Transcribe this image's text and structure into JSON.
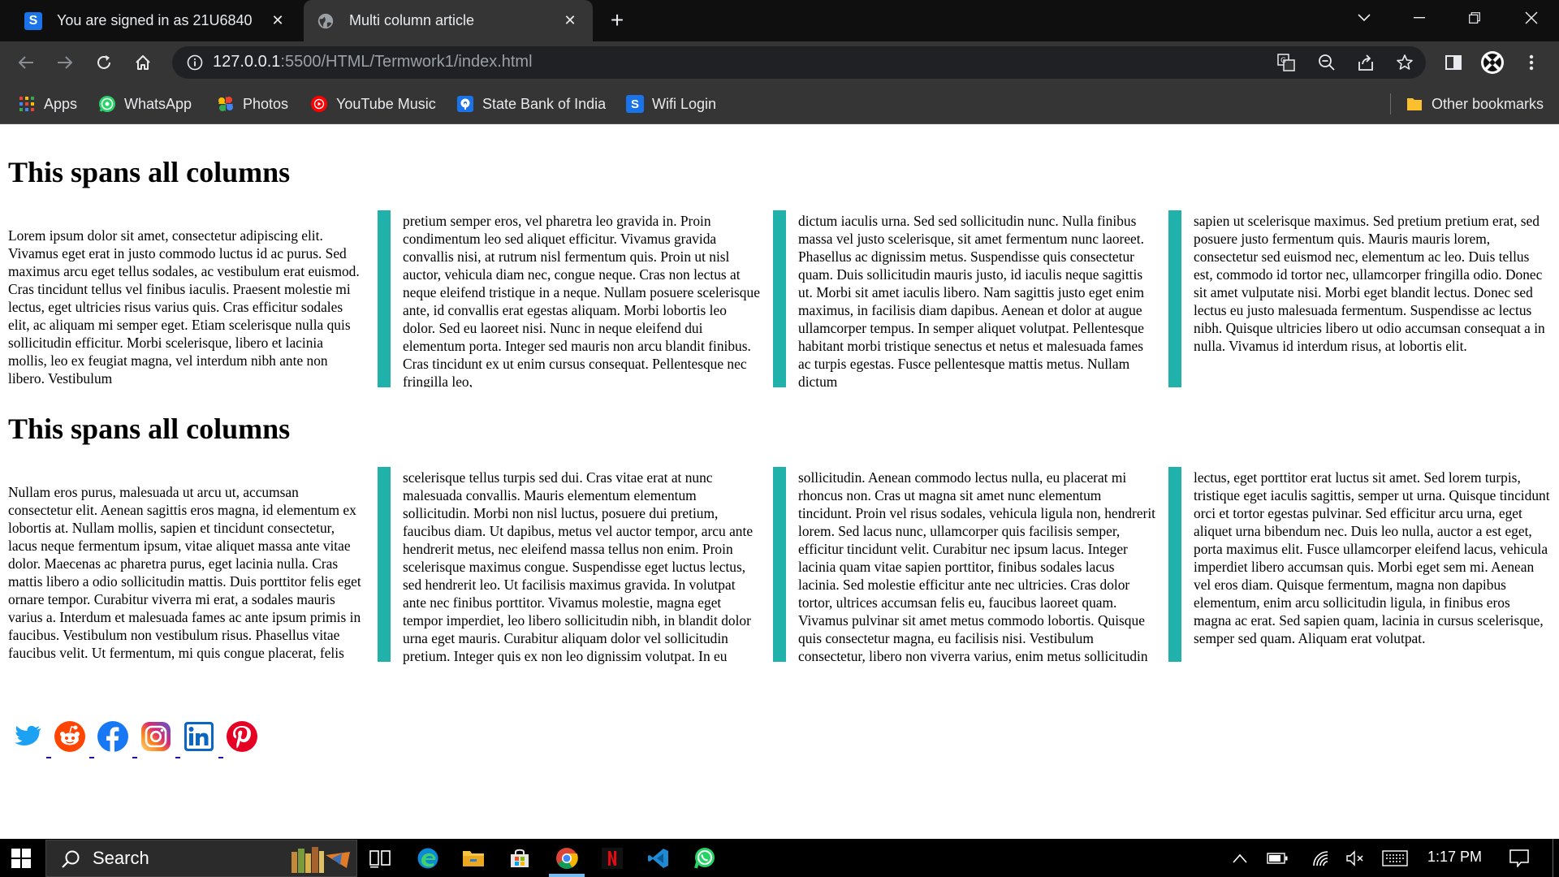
{
  "browser": {
    "tabs": [
      {
        "title": "You are signed in as 21U6840",
        "favicon": "s-logo"
      },
      {
        "title": "Multi column article",
        "favicon": "globe-icon"
      }
    ],
    "url_host": "127.0.0.1",
    "url_rest": ":5500/HTML/Termwork1/index.html"
  },
  "bookmarks": [
    {
      "label": "Apps",
      "icon": "apps-grid-icon"
    },
    {
      "label": "WhatsApp",
      "icon": "whatsapp-icon"
    },
    {
      "label": "Photos",
      "icon": "photos-icon"
    },
    {
      "label": "YouTube Music",
      "icon": "youtube-music-icon"
    },
    {
      "label": "State Bank of India",
      "icon": "sbi-icon"
    },
    {
      "label": "Wifi Login",
      "icon": "s-logo"
    }
  ],
  "other_bookmarks": "Other bookmarks",
  "page": {
    "sections": [
      {
        "heading": "This spans all columns",
        "columns": [
          "Lorem ipsum dolor sit amet, consectetur adipiscing elit. Vivamus eget erat in justo commodo luctus id ac purus. Sed maximus arcu eget tellus sodales, ac vestibulum erat euismod. Cras tincidunt tellus vel finibus iaculis. Praesent molestie mi lectus, eget ultricies risus varius quis. Cras efficitur sodales elit, ac aliquam mi semper eget. Etiam scelerisque nulla quis sollicitudin efficitur. Morbi scelerisque, libero et lacinia mollis, leo ex feugiat magna, vel interdum nibh ante non libero. Vestibulum",
          "pretium semper eros, vel pharetra leo gravida in. Proin condimentum leo sed aliquet efficitur. Vivamus gravida convallis nisi, at rutrum nisl fermentum quis. Proin ut nisl auctor, vehicula diam nec, congue neque. Cras non lectus at neque eleifend tristique in a neque. Nullam posuere scelerisque ante, id convallis erat egestas aliquam. Morbi lobortis leo dolor. Sed eu laoreet nisi. Nunc in neque eleifend dui elementum porta. Integer sed mauris non arcu blandit finibus. Cras tincidunt ex ut enim cursus consequat. Pellentesque nec fringilla leo,",
          "dictum iaculis urna. Sed sed sollicitudin nunc. Nulla finibus massa vel justo scelerisque, sit amet fermentum nunc laoreet. Phasellus ac dignissim metus. Suspendisse quis consectetur quam. Duis sollicitudin mauris justo, id iaculis neque sagittis ut. Morbi sit amet iaculis libero. Nam sagittis justo eget enim maximus, in facilisis diam dapibus. Aenean et dolor at augue ullamcorper tempus. In semper aliquet volutpat. Pellentesque habitant morbi tristique senectus et netus et malesuada fames ac turpis egestas. Fusce pellentesque mattis metus. Nullam dictum",
          "sapien ut scelerisque maximus. Sed pretium pretium erat, sed posuere justo fermentum quis. Mauris mauris lorem, consectetur sed euismod nec, elementum ac leo. Duis tellus est, commodo id tortor nec, ullamcorper fringilla odio. Donec sit amet vulputate nisi. Morbi eget blandit lectus. Donec sed lectus eu justo malesuada fermentum. Suspendisse ac lectus nibh. Quisque ultricies libero ut odio accumsan consequat a in nulla. Vivamus id interdum risus, at lobortis elit."
        ]
      },
      {
        "heading": "This spans all columns",
        "columns": [
          "Nullam eros purus, malesuada ut arcu ut, accumsan consectetur elit. Aenean sagittis eros magna, id elementum ex lobortis at. Nullam mollis, sapien et tincidunt consectetur, lacus neque fermentum ipsum, vitae aliquet massa ante vitae dolor. Maecenas ac pharetra purus, eget lacinia nulla. Cras mattis libero a odio sollicitudin mattis. Duis porttitor felis eget ornare tempor. Curabitur viverra mi erat, a sodales mauris varius a. Interdum et malesuada fames ac ante ipsum primis in faucibus. Vestibulum non vestibulum risus. Phasellus vitae faucibus velit. Ut fermentum, mi quis congue placerat, felis tellus fermentum diam, eget",
          "scelerisque tellus turpis sed dui. Cras vitae erat at nunc malesuada convallis. Mauris elementum elementum sollicitudin. Morbi non nisl luctus, posuere dui pretium, faucibus diam. Ut dapibus, metus vel auctor tempor, arcu ante hendrerit metus, nec eleifend massa tellus non enim. Proin scelerisque maximus congue. Suspendisse eget luctus lectus, sed hendrerit leo. Ut facilisis maximus gravida. In volutpat ante nec finibus porttitor. Vivamus molestie, magna eget tempor imperdiet, leo libero sollicitudin nibh, in blandit dolor urna eget mauris. Curabitur aliquam dolor vel sollicitudin pretium. Integer quis ex non leo dignissim volutpat. In eu posuere tortor. Suspendisse vitae metus non lacus sollicitudin",
          "sollicitudin. Aenean commodo lectus nulla, eu placerat mi rhoncus non. Cras ut magna sit amet nunc elementum tincidunt. Proin vel risus sodales, vehicula ligula non, hendrerit lorem. Sed lacus nunc, ullamcorper quis facilisis semper, efficitur tincidunt velit. Curabitur nec ipsum lacus. Integer lacinia quam vitae sapien porttitor, finibus sodales lacus lacinia. Sed molestie efficitur ante nec ultricies. Cras dolor tortor, ultrices accumsan felis eu, faucibus laoreet quam. Vivamus pulvinar sit amet metus commodo lobortis. Quisque quis consectetur magna, eu facilisis nisi. Vestibulum consectetur, libero non viverra varius, enim metus sollicitudin dolor, ut venenatis nibh ante vitae quam. Mauris porta libero",
          "lectus, eget porttitor erat luctus sit amet. Sed lorem turpis, tristique eget iaculis sagittis, semper ut urna. Quisque tincidunt orci et tortor egestas pulvinar. Sed efficitur arcu urna, eget aliquet urna bibendum nec. Duis leo nulla, auctor a est eget, porta maximus elit. Fusce ullamcorper eleifend lacus, vehicula imperdiet libero accumsan quis. Morbi eget sem mi. Aenean vel eros diam. Quisque fermentum, magna non dapibus elementum, enim arcu sollicitudin ligula, in finibus eros magna ac erat. Sed sapien quam, lacinia in cursus scelerisque, semper sed quam. Aliquam erat volutpat."
        ]
      }
    ],
    "social_links": [
      "twitter-icon",
      "reddit-icon",
      "facebook-icon",
      "instagram-icon",
      "linkedin-icon",
      "pinterest-icon"
    ],
    "rule_color": "#20b2aa"
  },
  "taskbar": {
    "search_placeholder": "Search",
    "time": "1:17 PM"
  }
}
